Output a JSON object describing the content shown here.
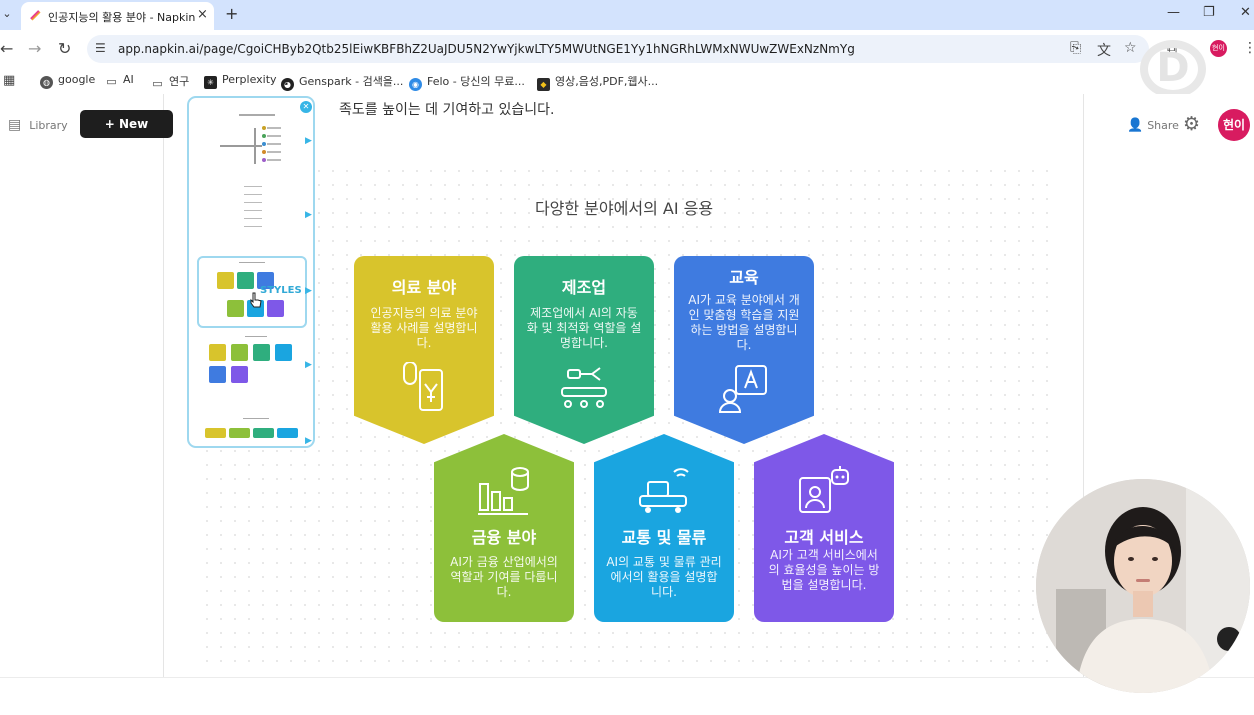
{
  "browser": {
    "tab_title": "인공지능의 활용 분야 - Napkin",
    "url": "app.napkin.ai/page/CgoiCHByb2Qtb25lEiwKBFBhZ2UaJDU5N2YwYjkwLTY5MWUtNGE1Yy1hNGRhLWMxNWUwZWExNzNmYg",
    "new_tab": "+",
    "close_glyph": "×"
  },
  "bookmarks": [
    {
      "label": "google"
    },
    {
      "label": "AI"
    },
    {
      "label": "연구"
    },
    {
      "label": "Perplexity"
    },
    {
      "label": "Genspark - 검색을..."
    },
    {
      "label": "Felo - 당신의 무료..."
    },
    {
      "label": "영상,음성,PDF,웹사..."
    }
  ],
  "app": {
    "library_label": "Library",
    "new_napkin_label": "+ New Napkin",
    "share_label": "Share",
    "avatar_label": "현이",
    "intro_text": "족도를 높이는 데 기여하고 있습니다.",
    "style_panel_label": "STYLES"
  },
  "visual": {
    "title": "다양한 분야에서의 AI 응용",
    "cards": [
      {
        "title": "의료 분야",
        "desc": "인공지능의 의료 분야 활용 사례를 설명합니다.",
        "color": "#d8c42c",
        "icon": "medical-device-icon"
      },
      {
        "title": "제조업",
        "desc": "제조업에서 AI의 자동화 및 최적화 역할을 설명합니다.",
        "color": "#2fae7e",
        "icon": "conveyor-robot-icon"
      },
      {
        "title": "교육",
        "desc": "AI가 교육 분야에서 개인 맞춤형 학습을 지원하는 방법을 설명합니다.",
        "color": "#3f7be0",
        "icon": "teacher-board-icon"
      },
      {
        "title": "금융 분야",
        "desc": "AI가 금융 산업에서의 역할과 기여를 다룹니다.",
        "color": "#8dc03a",
        "icon": "finance-chart-icon"
      },
      {
        "title": "교통 및 물류",
        "desc": "AI의 교통 및 물류 관리에서의 활용을 설명합니다.",
        "color": "#1aa5e0",
        "icon": "delivery-truck-icon"
      },
      {
        "title": "고객 서비스",
        "desc": "AI가 고객 서비스에서의 효율성을 높이는 방법을 설명합니다.",
        "color": "#7e58e8",
        "icon": "chatbot-agent-icon"
      }
    ]
  }
}
